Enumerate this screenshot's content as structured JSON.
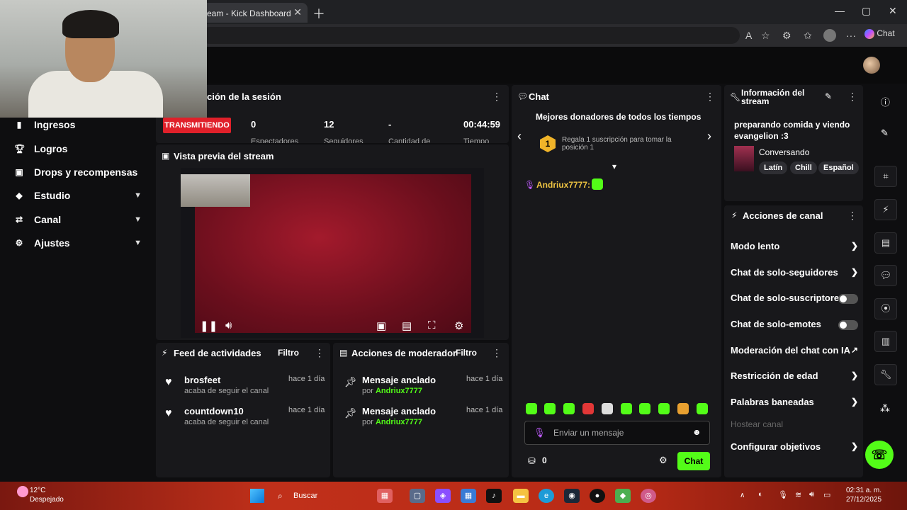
{
  "browser": {
    "tab_title": "eam - Kick Dashboard",
    "copilot_label": "Chat"
  },
  "sidebar": {
    "items": [
      {
        "label": "Ingresos",
        "icon": "wallet-icon"
      },
      {
        "label": "Logros",
        "icon": "trophy-icon"
      },
      {
        "label": "Drops y recompensas",
        "icon": "gift-icon"
      },
      {
        "label": "Estudio",
        "icon": "studio-icon"
      },
      {
        "label": "Canal",
        "icon": "channel-icon"
      },
      {
        "label": "Ajustes",
        "icon": "gear-icon"
      }
    ]
  },
  "session": {
    "title": "ción de la sesión",
    "live_badge": "TRANSMITIENDO",
    "viewers": "0",
    "viewers_label": "Espectadores",
    "followers": "12",
    "followers_label": "Seguidores",
    "subs": "-",
    "subs_label": "Cantidad de",
    "time": "00:44:59",
    "time_label": "Tiempo"
  },
  "preview": {
    "title": "Vista previa del stream"
  },
  "activity": {
    "title": "Feed de actividades",
    "filter": "Filtro",
    "items": [
      {
        "name": "brosfeet",
        "sub": "acaba de seguir el canal",
        "time": "hace 1 día"
      },
      {
        "name": "countdown10",
        "sub": "acaba de seguir el canal",
        "time": "hace 1 día"
      }
    ]
  },
  "moderator": {
    "title": "Acciones de moderador",
    "filter": "Filtro",
    "items": [
      {
        "name": "Mensaje anclado",
        "by": "por",
        "user": "Andriux7777",
        "time": "hace 1 día"
      },
      {
        "name": "Mensaje anclado",
        "by": "por",
        "user": "Andriux7777",
        "time": "hace 1 día"
      }
    ]
  },
  "chat": {
    "title": "Chat",
    "donors_title": "Mejores donadores de todos los tiempos",
    "donor_rank": "1",
    "donor_text": "Regala 1 suscripción para tomar la posición 1",
    "message_user": "Andriux7777:",
    "input_placeholder": "Enviar un mensaje",
    "points": "0",
    "send_label": "Chat"
  },
  "stream_info": {
    "title": "Información del stream",
    "stream_title": "preparando comida y viendo evangelion :3",
    "category": "Conversando",
    "tags": [
      "Latín",
      "Chill",
      "Español"
    ]
  },
  "channel_actions": {
    "title": "Acciones de canal",
    "items": [
      {
        "label": "Modo lento",
        "kind": "arrow"
      },
      {
        "label": "Chat de solo-seguidores",
        "kind": "arrow"
      },
      {
        "label": "Chat de solo-suscriptores",
        "kind": "toggle"
      },
      {
        "label": "Chat de solo-emotes",
        "kind": "toggle"
      },
      {
        "label": "Moderación del chat con IA",
        "kind": "external"
      },
      {
        "label": "Restricción de edad",
        "kind": "arrow"
      },
      {
        "label": "Palabras baneadas",
        "kind": "arrow"
      },
      {
        "label": "Hostear canal",
        "kind": "disabled"
      },
      {
        "label": "Configurar objetivos",
        "kind": "arrow"
      }
    ]
  },
  "taskbar": {
    "weather_temp": "12°C",
    "weather_desc": "Despejado",
    "search": "Buscar",
    "time": "02:31 a. m.",
    "date": "27/12/2025"
  },
  "colors": {
    "kick_green": "#53fc18",
    "live_red": "#e0202a",
    "panel": "#18181b"
  }
}
